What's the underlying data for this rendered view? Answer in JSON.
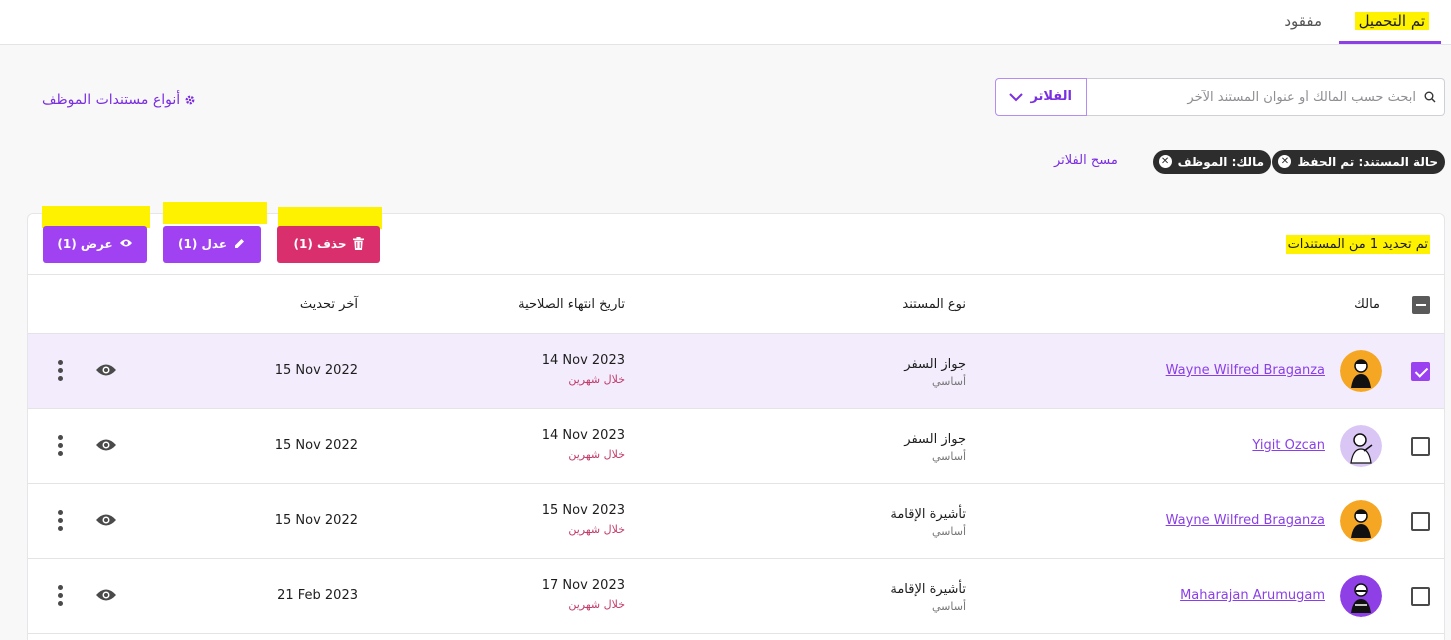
{
  "tabs": {
    "active": "تم التحميل",
    "missing": "مفقود"
  },
  "search": {
    "placeholder": "ابحث حسب المالك أو عنوان المستند الآخر"
  },
  "filter": {
    "label": "الفلاتر"
  },
  "doc_types_link": "أنواع مستندات الموظف",
  "chips": {
    "status": "حالة المستند: تم الحفظ",
    "owner": "مالك: الموظف"
  },
  "clear_filters": "مسح الفلاتر",
  "toolbar": {
    "selected_count": "تم تحديد 1 من المستندات",
    "delete": "حذف (1)",
    "edit": "عدل (1)",
    "view": "عرض (1)"
  },
  "table": {
    "headers": {
      "owner": "مالك",
      "doc_type": "نوع المستند",
      "expiry": "تاريخ انتهاء الصلاحية",
      "updated": "آخر تحديث"
    },
    "rows": [
      {
        "owner": "Wayne Wilfred Braganza",
        "doc_type": "جواز السفر",
        "doc_sub": "أساسي",
        "expiry": "14 Nov 2023",
        "expiry_note": "خلال شهرين",
        "updated": "15 Nov 2022",
        "checked": true,
        "avatar_color": "#f5a623"
      },
      {
        "owner": "Yigit Ozcan",
        "doc_type": "جواز السفر",
        "doc_sub": "أساسي",
        "expiry": "14 Nov 2023",
        "expiry_note": "خلال شهرين",
        "updated": "15 Nov 2022",
        "checked": false,
        "avatar_color": "#d9c6f5"
      },
      {
        "owner": "Wayne Wilfred Braganza",
        "doc_type": "تأشيرة الإقامة",
        "doc_sub": "أساسي",
        "expiry": "15 Nov 2023",
        "expiry_note": "خلال شهرين",
        "updated": "15 Nov 2022",
        "checked": false,
        "avatar_color": "#f5a623"
      },
      {
        "owner": "Maharajan Arumugam",
        "doc_type": "تأشيرة الإقامة",
        "doc_sub": "أساسي",
        "expiry": "17 Nov 2023",
        "expiry_note": "خلال شهرين",
        "updated": "21 Feb 2023",
        "checked": false,
        "avatar_color": "#8e3fe6"
      }
    ]
  }
}
